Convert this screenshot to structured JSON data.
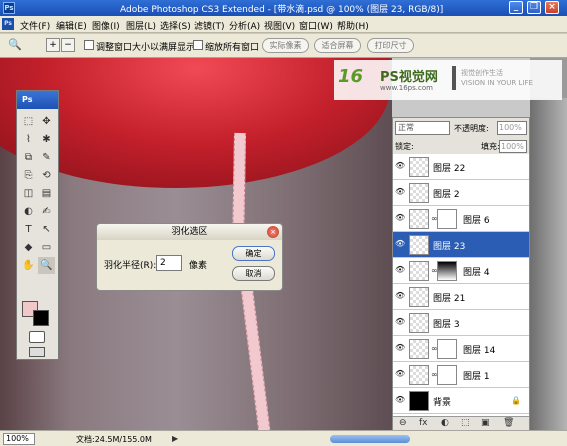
{
  "titlebar": {
    "app_badge": "Ps",
    "title": "Adobe Photoshop CS3 Extended - [带水滴.psd @ 100% (图层 23, RGB/8)]",
    "minimize": "_",
    "restore": "❐",
    "close": "×"
  },
  "menubar": {
    "badge": "Ps",
    "items": [
      "文件(F)",
      "编辑(E)",
      "图像(I)",
      "图层(L)",
      "选择(S)",
      "滤镜(T)",
      "分析(A)",
      "视图(V)",
      "窗口(W)",
      "帮助(H)"
    ]
  },
  "options": {
    "tool_icon": "🔍",
    "zoom_in": "+",
    "zoom_out": "−",
    "resize_window": "调整窗口大小以满屏显示",
    "zoom_all": "缩放所有窗口",
    "actual_pixels": "实际像素",
    "fit_screen": "适合屏幕",
    "print_size": "打印尺寸"
  },
  "watermark": {
    "symbol": "16",
    "brand": "PS视觉网",
    "url": "www.16ps.com",
    "slogan_1": "视觉创作生活",
    "slogan_2": "VISION IN YOUR LIFE"
  },
  "tools": {
    "header": "Ps",
    "icons": [
      "⬚",
      "✥",
      "⌇",
      "✱",
      "⧉",
      "✎",
      "⎘",
      "⟲",
      "◫",
      "▤",
      "◐",
      "✍",
      "T",
      "↖",
      "◆",
      "▭",
      "✋",
      "🔍"
    ]
  },
  "dialog": {
    "title": "羽化选区",
    "close": "×",
    "radius_label": "羽化半径(R):",
    "radius_value": "2",
    "unit": "像素",
    "ok": "确定",
    "cancel": "取消"
  },
  "layers": {
    "blend_mode": "正常",
    "opacity_label": "不透明度:",
    "opacity_value": "100%",
    "lock_label": "锁定:",
    "fill_label": "填充:",
    "fill_value": "100%",
    "rows": [
      {
        "name": "图层 22",
        "selected": false,
        "mask": false
      },
      {
        "name": "图层 2",
        "selected": false,
        "mask": false
      },
      {
        "name": "图层 6",
        "selected": false,
        "mask": true
      },
      {
        "name": "图层 23",
        "selected": true,
        "mask": false
      },
      {
        "name": "图层 4",
        "selected": false,
        "mask": true
      },
      {
        "name": "图层 21",
        "selected": false,
        "mask": false
      },
      {
        "name": "图层 3",
        "selected": false,
        "mask": false
      },
      {
        "name": "图层 14",
        "selected": false,
        "mask": true
      },
      {
        "name": "图层 1",
        "selected": false,
        "mask": true
      },
      {
        "name": "背景",
        "selected": false,
        "mask": false
      }
    ],
    "footer_icons": [
      "⊖",
      "fx",
      "◐",
      "⬚",
      "▣",
      "🗑"
    ]
  },
  "status": {
    "zoom": "100%",
    "doc": "文档:24.5M/155.0M"
  }
}
